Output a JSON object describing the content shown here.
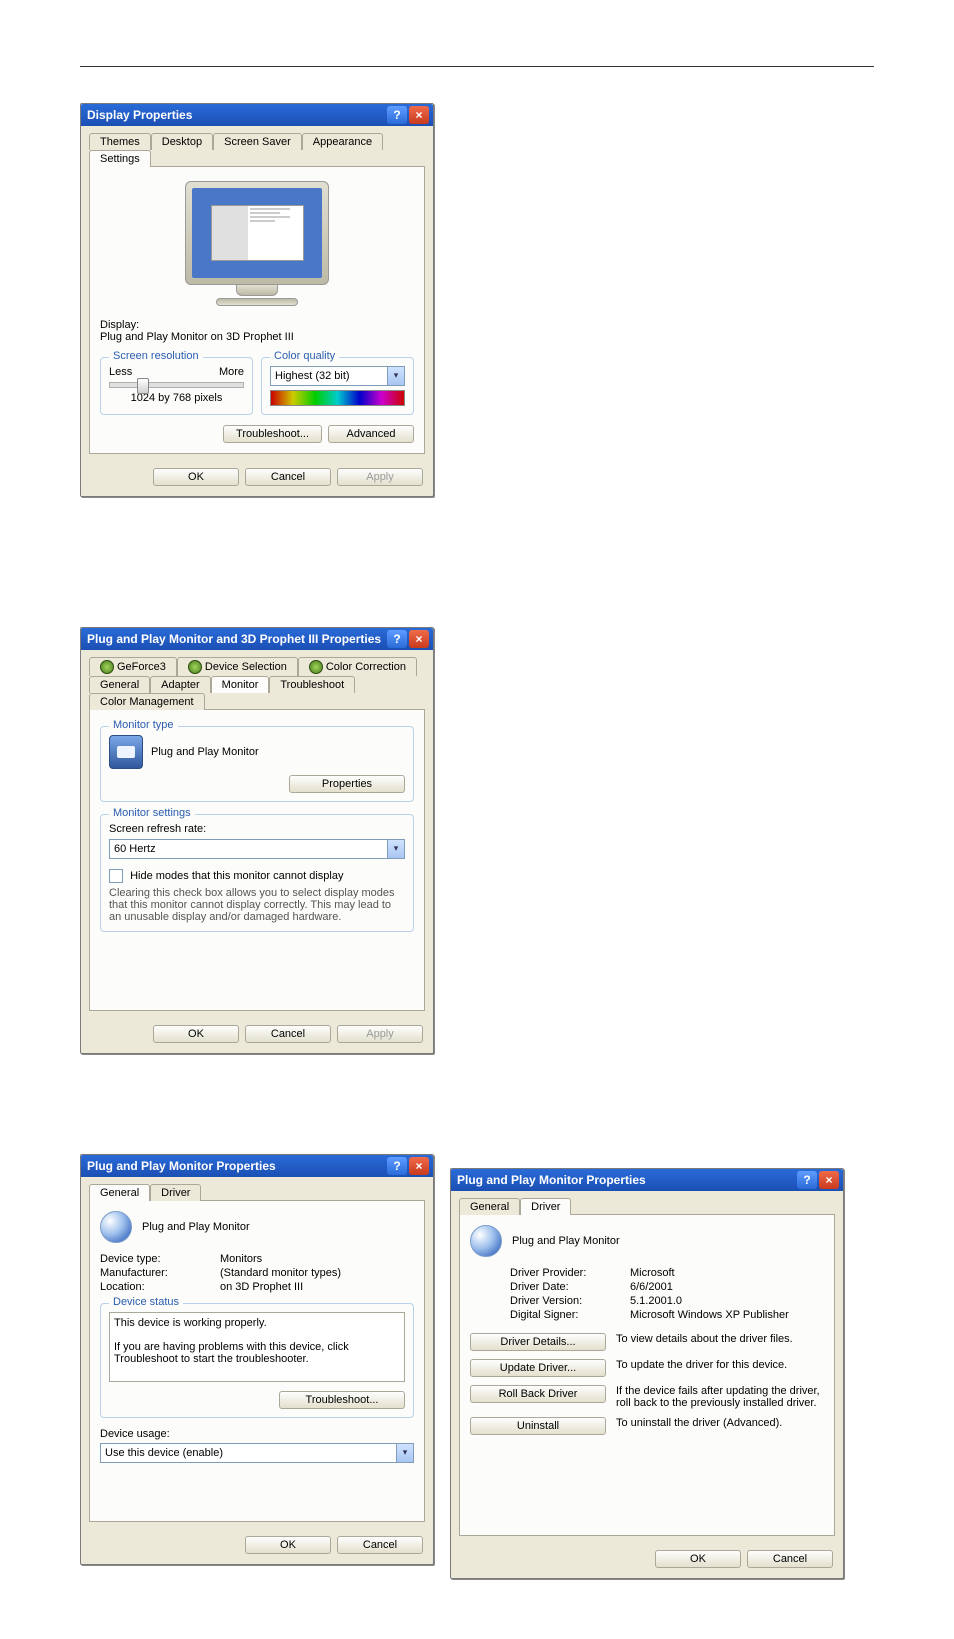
{
  "displayProps": {
    "title": "Display Properties",
    "tabs": [
      "Themes",
      "Desktop",
      "Screen Saver",
      "Appearance",
      "Settings"
    ],
    "activeTab": 4,
    "displayLabel": "Display:",
    "displayValue": "Plug and Play Monitor on 3D Prophet III",
    "screenRes": {
      "legend": "Screen resolution",
      "less": "Less",
      "more": "More",
      "value": "1024 by 768 pixels"
    },
    "colorQuality": {
      "legend": "Color quality",
      "value": "Highest (32 bit)"
    },
    "troubleshoot": "Troubleshoot...",
    "advanced": "Advanced",
    "ok": "OK",
    "cancel": "Cancel",
    "apply": "Apply"
  },
  "advProps": {
    "title": "Plug and Play Monitor and 3D Prophet III Properties",
    "tabsTop": [
      "GeForce3",
      "Device Selection",
      "Color Correction"
    ],
    "tabsBottom": [
      "General",
      "Adapter",
      "Monitor",
      "Troubleshoot",
      "Color Management"
    ],
    "activeBottom": 2,
    "monitorType": {
      "legend": "Monitor type",
      "name": "Plug and Play Monitor",
      "propertiesBtn": "Properties"
    },
    "monitorSettings": {
      "legend": "Monitor settings",
      "refreshLabel": "Screen refresh rate:",
      "refreshValue": "60 Hertz",
      "hideModes": "Hide modes that this monitor cannot display",
      "hideDesc": "Clearing this check box allows you to select display modes that this monitor cannot display correctly. This may lead to an unusable display and/or damaged hardware."
    },
    "ok": "OK",
    "cancel": "Cancel",
    "apply": "Apply"
  },
  "monPropsGeneral": {
    "title": "Plug and Play Monitor Properties",
    "tabs": [
      "General",
      "Driver"
    ],
    "activeTab": 0,
    "name": "Plug and Play Monitor",
    "deviceTypeLabel": "Device type:",
    "deviceType": "Monitors",
    "manufacturerLabel": "Manufacturer:",
    "manufacturer": "(Standard monitor types)",
    "locationLabel": "Location:",
    "location": "on 3D Prophet III",
    "statusLegend": "Device status",
    "statusText": "This device is working properly.\n\nIf you are having problems with this device, click Troubleshoot to start the troubleshooter.",
    "troubleshoot": "Troubleshoot...",
    "usageLabel": "Device usage:",
    "usageValue": "Use this device (enable)",
    "ok": "OK",
    "cancel": "Cancel"
  },
  "monPropsDriver": {
    "title": "Plug and Play Monitor Properties",
    "tabs": [
      "General",
      "Driver"
    ],
    "activeTab": 1,
    "name": "Plug and Play Monitor",
    "providerLabel": "Driver Provider:",
    "provider": "Microsoft",
    "dateLabel": "Driver Date:",
    "date": "6/6/2001",
    "versionLabel": "Driver Version:",
    "version": "5.1.2001.0",
    "signerLabel": "Digital Signer:",
    "signer": "Microsoft Windows XP Publisher",
    "detailsBtn": "Driver Details...",
    "detailsDesc": "To view details about the driver files.",
    "updateBtn": "Update Driver...",
    "updateDesc": "To update the driver for this device.",
    "rollbackBtn": "Roll Back Driver",
    "rollbackDesc": "If the device fails after updating the driver, roll back to the previously installed driver.",
    "uninstallBtn": "Uninstall",
    "uninstallDesc": "To uninstall the driver (Advanced).",
    "ok": "OK",
    "cancel": "Cancel"
  }
}
